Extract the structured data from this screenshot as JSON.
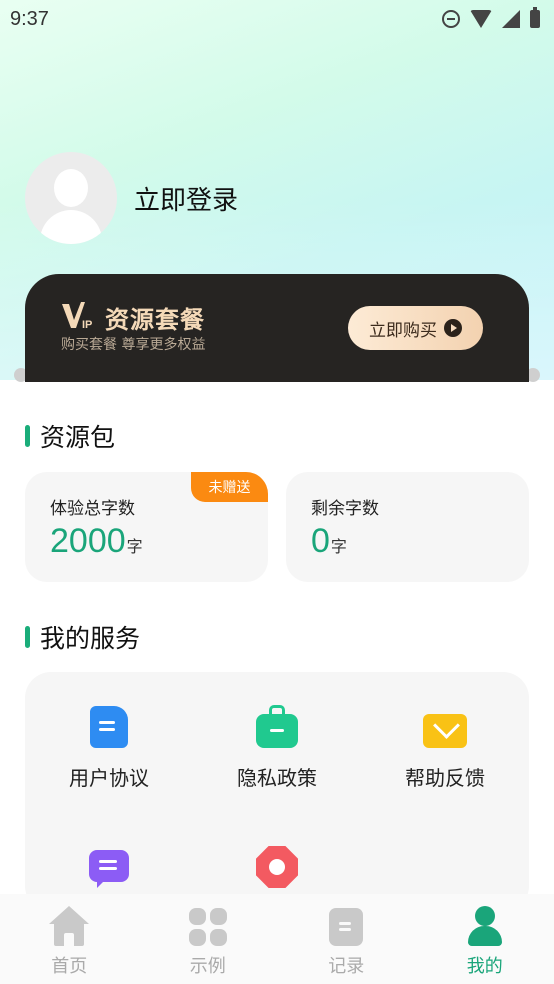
{
  "status_bar": {
    "time": "9:37",
    "icons": [
      "do-not-disturb-icon",
      "wifi-icon",
      "signal-icon",
      "battery-icon"
    ]
  },
  "profile": {
    "login_label": "立即登录"
  },
  "vip": {
    "logo_text": "VIP",
    "title": "资源套餐",
    "subtitle": "购买套餐 尊享更多权益",
    "buy_label": "立即购买"
  },
  "resource_section": {
    "title": "资源包",
    "cards": [
      {
        "label": "体验总字数",
        "value": "2000",
        "unit": "字",
        "badge": "未赠送"
      },
      {
        "label": "剩余字数",
        "value": "0",
        "unit": "字"
      }
    ]
  },
  "services_section": {
    "title": "我的服务",
    "items": [
      {
        "label": "用户协议",
        "icon": "document-icon"
      },
      {
        "label": "隐私政策",
        "icon": "briefcase-icon"
      },
      {
        "label": "帮助反馈",
        "icon": "mail-icon"
      },
      {
        "label": "",
        "icon": "chat-icon"
      },
      {
        "label": "",
        "icon": "octagon-icon"
      }
    ]
  },
  "tabbar": {
    "tabs": [
      {
        "label": "首页",
        "icon": "home-icon",
        "active": false
      },
      {
        "label": "示例",
        "icon": "grid-icon",
        "active": false
      },
      {
        "label": "记录",
        "icon": "record-icon",
        "active": false
      },
      {
        "label": "我的",
        "icon": "profile-icon",
        "active": true
      }
    ]
  },
  "colors": {
    "accent": "#1aa57a",
    "badge": "#fb8a11",
    "vip_card": "#262422",
    "vip_gold": "#f4d9b8"
  }
}
